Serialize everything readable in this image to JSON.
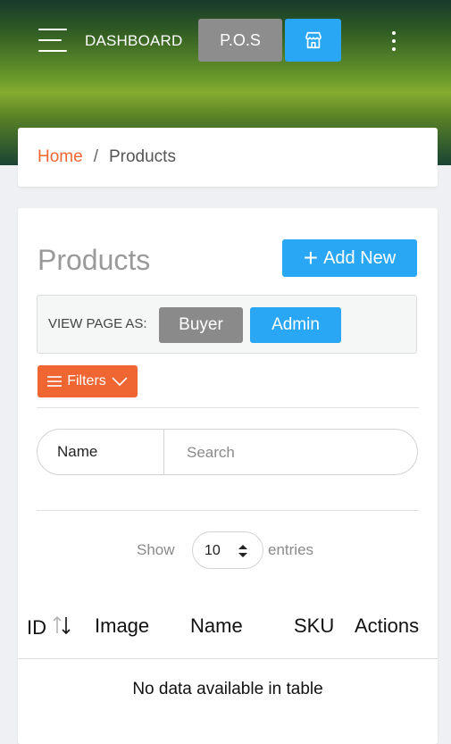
{
  "header": {
    "title": "DASHBOARD",
    "pos_label": "P.O.S",
    "menu_icon": "hamburger-icon",
    "store_icon": "store-icon",
    "more_icon": "kebab-menu-icon"
  },
  "breadcrumb": {
    "home": "Home",
    "separator": "/",
    "current": "Products"
  },
  "page": {
    "title": "Products",
    "add_label": "Add New"
  },
  "view_as": {
    "label": "VIEW PAGE AS:",
    "buyer": "Buyer",
    "admin": "Admin"
  },
  "filters": {
    "label": "Filters"
  },
  "search": {
    "field_label": "Name",
    "placeholder": "Search"
  },
  "entries": {
    "show": "Show",
    "value": "10",
    "suffix": "entries"
  },
  "table": {
    "columns": [
      "ID",
      "Image",
      "Name",
      "SKU",
      "Actions"
    ],
    "empty_message": "No data available in table"
  },
  "colors": {
    "accent_blue": "#2aa7f4",
    "accent_orange": "#ef6632",
    "muted_gray": "#8a8a8a"
  }
}
